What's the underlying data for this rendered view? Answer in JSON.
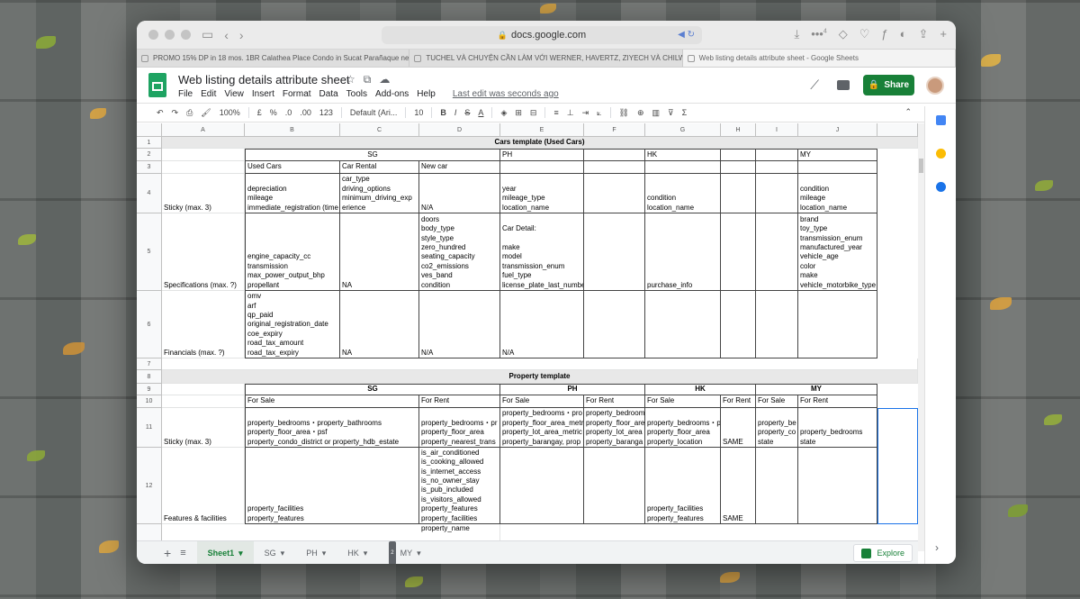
{
  "browser": {
    "url": "docs.google.com",
    "tabs": [
      {
        "label": "PROMO 15% DP in 18 mos. 1BR Calathea Place Condo in Sucat Parañaque ne..."
      },
      {
        "label": "TUCHEL VÀ CHUYỆN CẦN LÀM VỚI WERNER, HAVERTZ, ZIYECH VÀ CHILW..."
      },
      {
        "label": "Web listing details attribute sheet - Google Sheets"
      }
    ],
    "badge_count": "4"
  },
  "doc": {
    "title": "Web listing details attribute sheet",
    "menu": [
      "File",
      "Edit",
      "View",
      "Insert",
      "Format",
      "Data",
      "Tools",
      "Add-ons",
      "Help"
    ],
    "last_edit": "Last edit was seconds ago",
    "share_label": "Share"
  },
  "toolbar": {
    "zoom": "100%",
    "currency": "£",
    "percent": "%",
    "dec_less": ".0",
    "dec_more": ".00",
    "number_format": "123",
    "font": "Default (Ari...",
    "font_size": "10",
    "bold": "B",
    "italic": "I",
    "strike": "S",
    "underline_a": "A",
    "sigma": "Σ"
  },
  "columns": [
    "A",
    "B",
    "C",
    "D",
    "E",
    "F",
    "G",
    "H",
    "I",
    "J"
  ],
  "rows": [
    "1",
    "2",
    "3",
    "4",
    "5",
    "6",
    "7",
    "8",
    "9",
    "10",
    "11",
    "12"
  ],
  "cars": {
    "band": "Cars template (Used Cars)",
    "region_sg": "SG",
    "region_ph": "PH",
    "region_hk": "HK",
    "region_my": "MY",
    "sub_used": "Used Cars",
    "sub_rental": "Car Rental",
    "sub_new": "New car",
    "sticky_label": "Sticky (max. 3)",
    "sticky_b": [
      "depreciation",
      "mileage",
      "immediate_registration (time"
    ],
    "sticky_c": [
      "car_type",
      "driving_options",
      "minimum_driving_exp",
      "erience"
    ],
    "sticky_d": [
      "N/A"
    ],
    "sticky_e": [
      "year",
      "mileage_type",
      "location_name"
    ],
    "sticky_g": [
      "condition",
      "location_name"
    ],
    "sticky_j": [
      "condition",
      "mileage",
      "location_name"
    ],
    "spec_label": "Specifications (max. ?)",
    "spec_b": [
      "engine_capacity_cc",
      "transmission",
      "max_power_output_bhp",
      "propellant"
    ],
    "spec_c": [
      "NA"
    ],
    "spec_d": [
      "doors",
      "body_type",
      "style_type",
      "zero_hundred",
      "seating_capacity",
      "co2_emissions",
      "ves_band",
      "condition"
    ],
    "spec_e": [
      "Car Detail:",
      "",
      "make",
      "model",
      "transmission_enum",
      "fuel_type",
      "license_plate_last_number"
    ],
    "spec_g": [
      "purchase_info"
    ],
    "spec_j": [
      "brand",
      "toy_type",
      "transmission_enum",
      "manufactured_year",
      "vehicle_age",
      "color",
      "make",
      "vehicle_motorbike_type"
    ],
    "fin_label": "Financials (max. ?)",
    "fin_b": [
      "omv",
      "arf",
      "qp_paid",
      "original_registration_date",
      "coe_expiry",
      "road_tax_amount",
      "road_tax_expiry"
    ],
    "fin_c": [
      "NA"
    ],
    "fin_d": [
      "N/A"
    ],
    "fin_e": [
      "N/A"
    ]
  },
  "property": {
    "band": "Property template",
    "region_sg": "SG",
    "region_ph": "PH",
    "region_hk": "HK",
    "region_my": "MY",
    "for_sale": "For Sale",
    "for_rent": "For Rent",
    "sticky_label": "Sticky (max. 3)",
    "sticky_b": [
      "property_bedrooms・property_bathrooms",
      "property_floor_area・psf",
      "property_condo_district or property_hdb_estate"
    ],
    "sticky_d": [
      "property_bedrooms・pr",
      "property_floor_area",
      "property_nearest_trans"
    ],
    "sticky_e": [
      "property_bedrooms・pro",
      "property_floor_area_metr",
      "property_lot_area_metric",
      "property_barangay, prop"
    ],
    "sticky_f": [
      "property_bedroom",
      "property_floor_are",
      "property_lot_area",
      "property_baranga"
    ],
    "sticky_g": [
      "property_bedrooms・p",
      "property_floor_area",
      "property_location"
    ],
    "sticky_h": [
      "SAME"
    ],
    "sticky_i": [
      "property_be",
      "property_co",
      "state"
    ],
    "sticky_j": [
      "property_bedrooms",
      "state"
    ],
    "feat_label": "Features & facilities",
    "feat_b": [
      "property_facilities",
      "property_features"
    ],
    "feat_d": [
      "is_air_conditioned",
      "is_cooking_allowed",
      "is_internet_access",
      "is_no_owner_stay",
      "is_pub_included",
      "is_visitors_allowed",
      "property_features",
      "property_facilities"
    ],
    "feat_g": [
      "property_facilities",
      "property_features"
    ],
    "feat_h": [
      "SAME"
    ],
    "row13_d": "property_name"
  },
  "sheets": [
    {
      "label": "Sheet1"
    },
    {
      "label": "SG"
    },
    {
      "label": "PH"
    },
    {
      "label": "HK"
    },
    {
      "label": "MY",
      "badge": "2"
    }
  ],
  "explore_label": "Explore",
  "colors": {
    "sheets_green": "#188038",
    "band_gray": "#e8e8e8"
  }
}
